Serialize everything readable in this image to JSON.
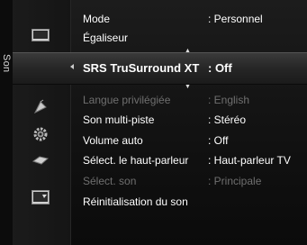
{
  "category": "Son",
  "menu": {
    "items": [
      {
        "label": "Mode",
        "value": ": Personnel",
        "state": "normal"
      },
      {
        "label": "Égaliseur",
        "value": "",
        "state": "normal"
      },
      {
        "label": "SRS TruSurround XT",
        "value": ": Off",
        "state": "selected"
      },
      {
        "label": "Langue privilégiée",
        "value": ": English",
        "state": "disabled"
      },
      {
        "label": "Son multi-piste",
        "value": ": Stéréo",
        "state": "normal"
      },
      {
        "label": "Volume auto",
        "value": ": Off",
        "state": "normal"
      },
      {
        "label": "Sélect. le haut-parleur",
        "value": ": Haut-parleur TV",
        "state": "normal"
      },
      {
        "label": "Sélect. son",
        "value": ": Principale",
        "state": "disabled"
      },
      {
        "label": "Réinitialisation du son",
        "value": "",
        "state": "normal"
      }
    ]
  },
  "icons": [
    "picture-icon",
    "sound-icon",
    "channel-icon",
    "setup-icon",
    "input-icon",
    "application-icon"
  ],
  "colors": {
    "text": "#ffffff",
    "disabled": "#6f6f6f",
    "background": "#141414"
  }
}
